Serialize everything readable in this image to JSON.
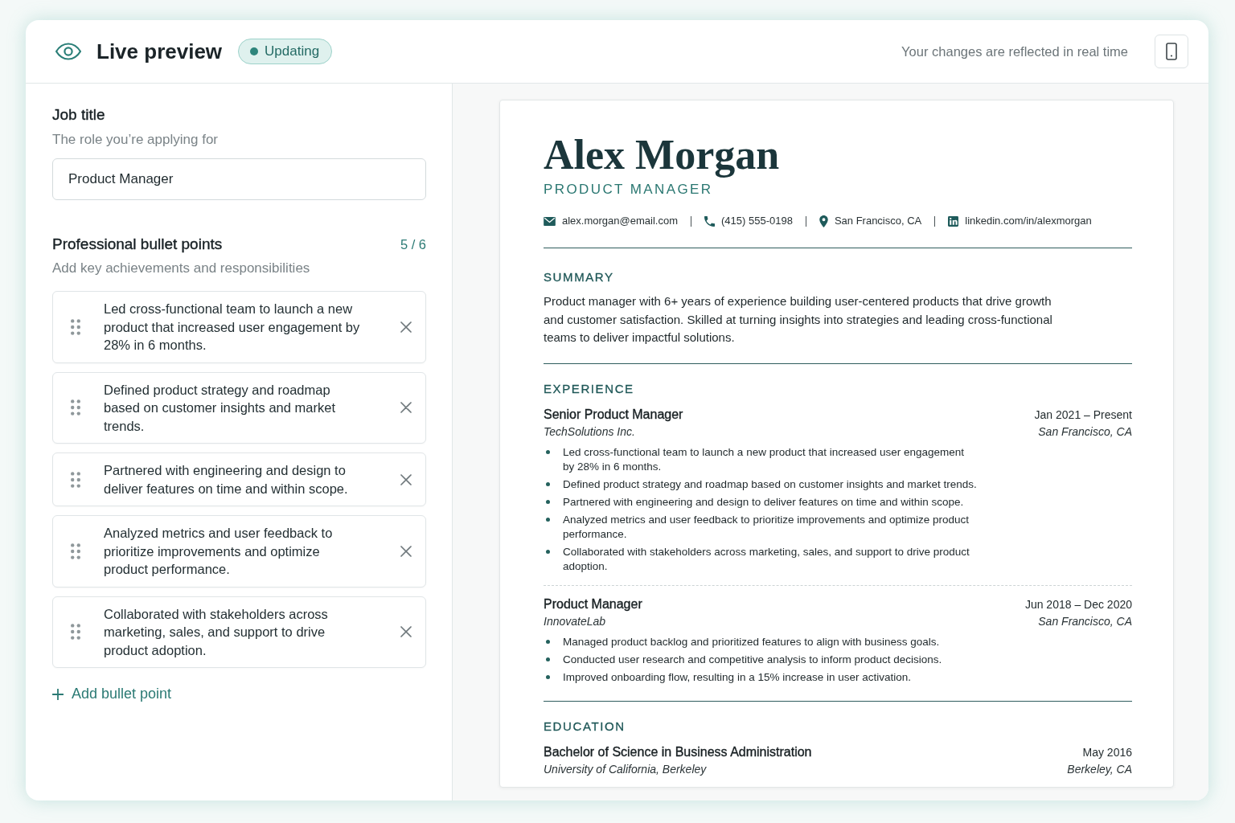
{
  "header": {
    "title": "Live preview",
    "status": "Updating",
    "hint": "Your changes are reflected in real time"
  },
  "editor": {
    "job_title": {
      "label": "Job title",
      "description": "The role you’re applying for",
      "value": "Product Manager"
    },
    "bullet_points": {
      "label": "Professional bullet points",
      "count": "5 / 6",
      "description": "Add key achievements and responsibilities",
      "items": [
        {
          "text": "Led cross-functional team to launch a new product that increased user engagement by 28% in 6 months."
        },
        {
          "text": "Defined product strategy and roadmap based on customer insights and market trends."
        },
        {
          "text": "Partnered with engineering and design to deliver features on time and within scope."
        },
        {
          "text": "Analyzed metrics and user feedback to prioritize improvements and optimize product performance."
        },
        {
          "text": "Collaborated with stakeholders across marketing, sales, and support to drive product adoption."
        }
      ],
      "add_label": "Add bullet point"
    }
  },
  "resume": {
    "name": "Alex Morgan",
    "headline": "PRODUCT MANAGER",
    "contacts": [
      {
        "kind": "email",
        "text": "alex.morgan@email.com"
      },
      {
        "kind": "phone",
        "text": "(415) 555-0198"
      },
      {
        "kind": "location",
        "text": "San Francisco, CA"
      },
      {
        "kind": "linkedin",
        "text": "linkedin.com/in/alexmorgan"
      }
    ],
    "sections": [
      {
        "kind": "summary",
        "heading": "SUMMARY",
        "text": "Product manager with 6+ years of experience building user-centered products that drive growth and customer satisfaction. Skilled at turning insights into strategies and leading cross-functional teams to deliver impactful solutions."
      },
      {
        "kind": "entries",
        "heading": "EXPERIENCE",
        "entries": [
          {
            "title": "Senior Product Manager",
            "organization": "TechSolutions Inc.",
            "dates": "Jan 2021 – Present",
            "location": "San Francisco, CA",
            "bullets": [
              "Led cross-functional team to launch a new product that increased user engagement by 28% in 6 months.",
              "Defined product strategy and roadmap based on customer insights and market trends.",
              "Partnered with engineering and design to deliver features on time and within scope.",
              "Analyzed metrics and user feedback to prioritize improvements and optimize product performance.",
              "Collaborated with stakeholders across marketing, sales, and support to drive product adoption."
            ]
          },
          {
            "title": "Product Manager",
            "organization": "InnovateLab",
            "dates": "Jun 2018 – Dec 2020",
            "location": "San Francisco, CA",
            "bullets": [
              "Managed product backlog and prioritized features to align with business goals.",
              "Conducted user research and competitive analysis to inform product decisions.",
              "Improved onboarding flow, resulting in a 15% increase in user activation."
            ]
          }
        ]
      },
      {
        "kind": "entries",
        "heading": "EDUCATION",
        "entries": [
          {
            "title": "Bachelor of Science in Business Administration",
            "organization": "University of California, Berkeley",
            "dates": "May 2016",
            "location": "Berkeley, CA"
          }
        ]
      }
    ]
  }
}
